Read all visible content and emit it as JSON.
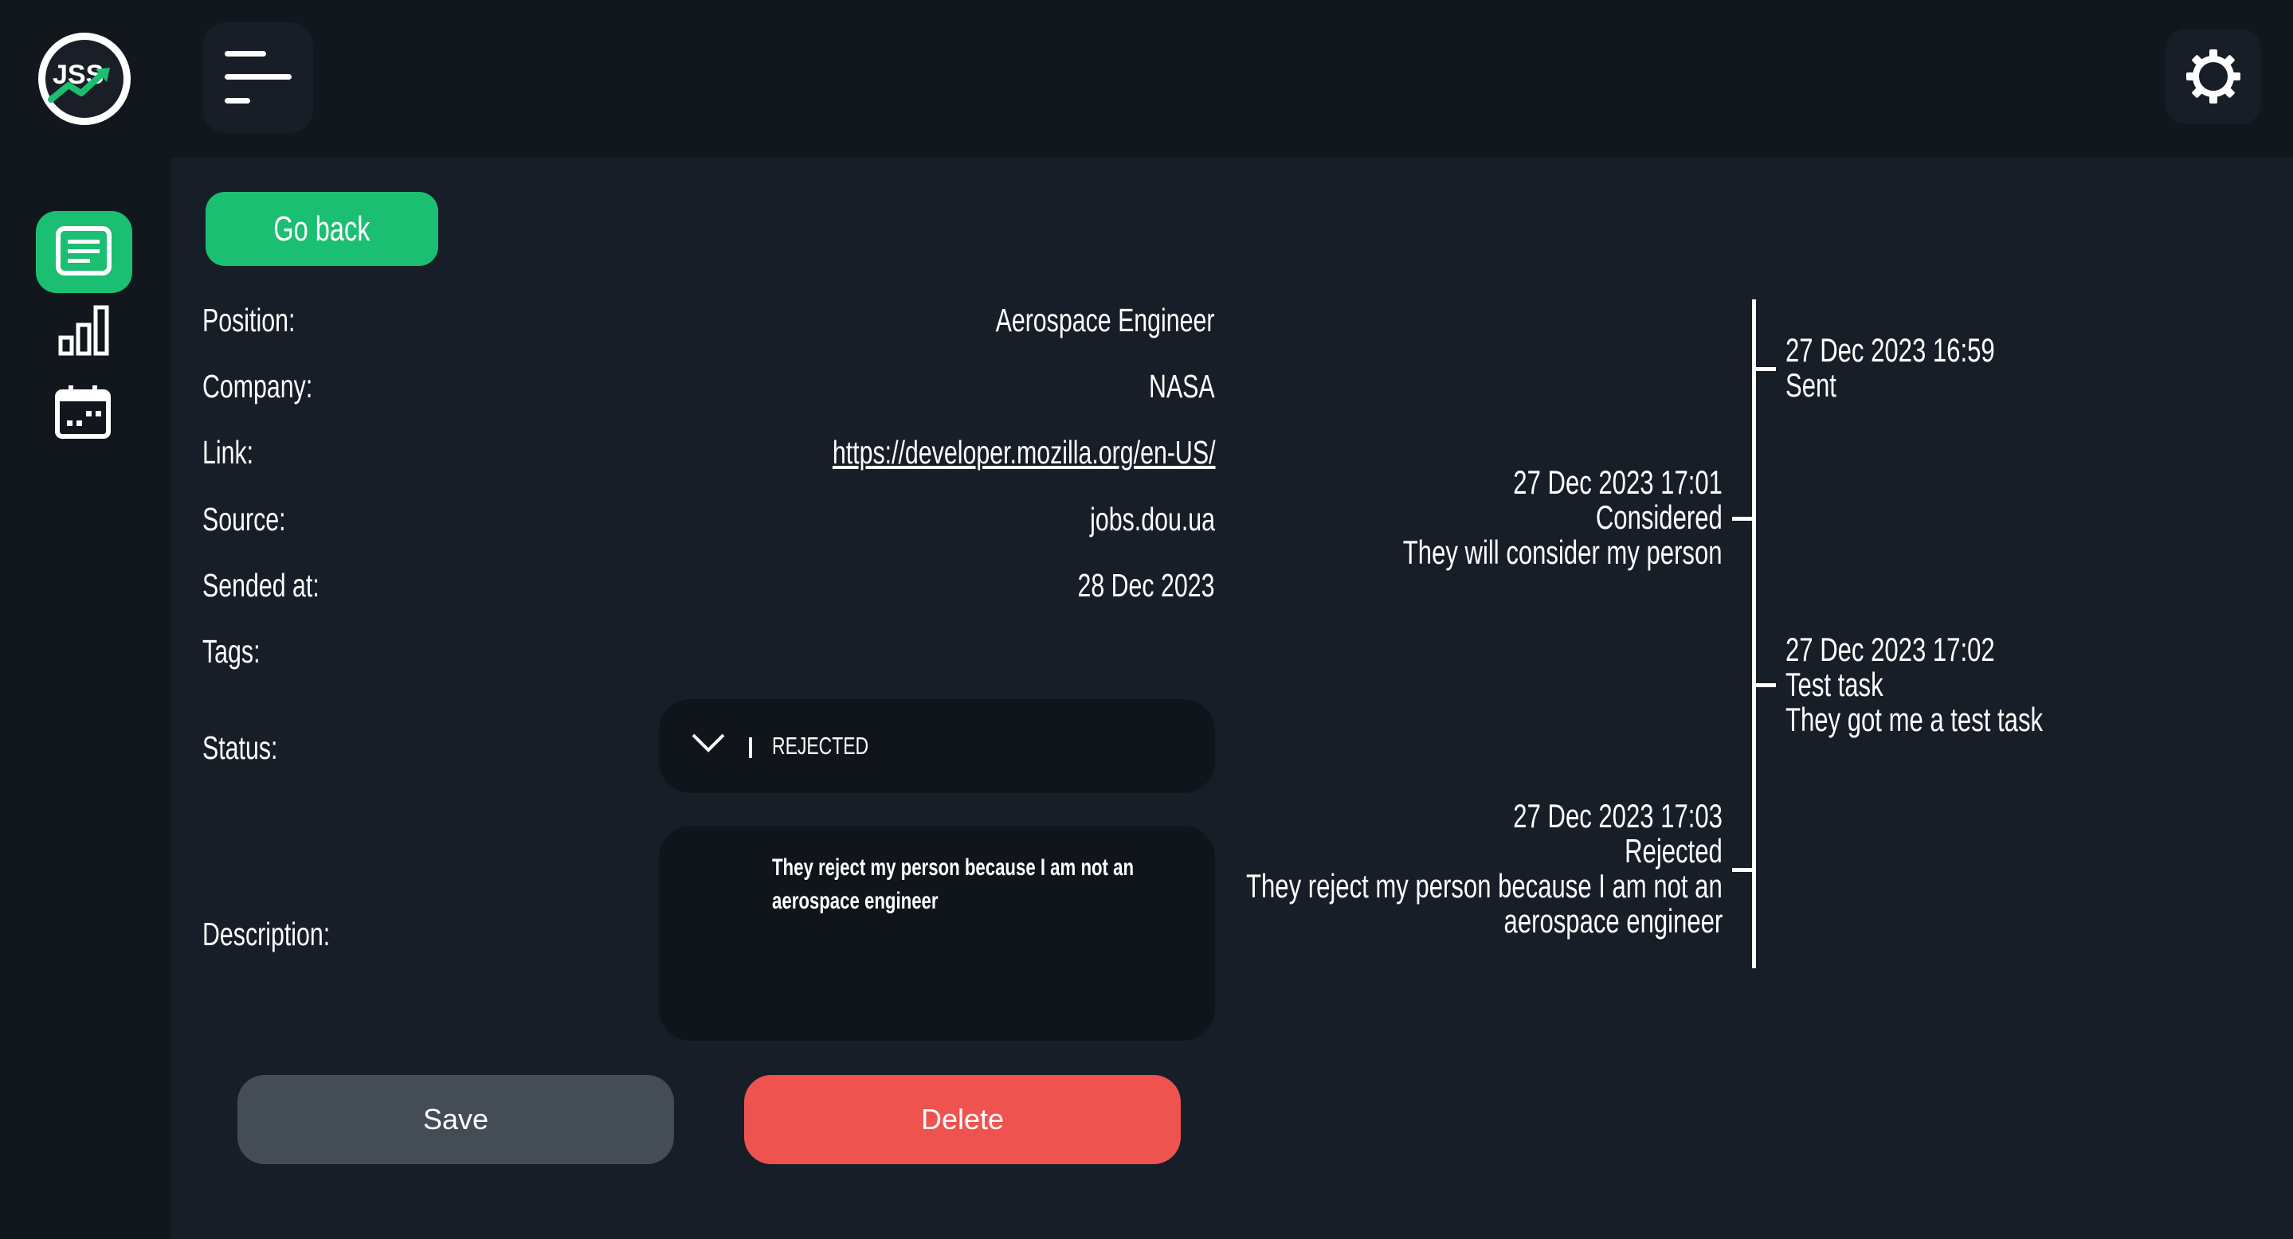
{
  "app": {
    "logo_text": "JSS"
  },
  "header": {
    "menu_icon": "hamburger-icon",
    "settings_icon": "gear-icon"
  },
  "sidebar": {
    "items": [
      {
        "name": "applications",
        "icon": "list-icon",
        "active": true
      },
      {
        "name": "statistics",
        "icon": "bar-chart-icon",
        "active": false
      },
      {
        "name": "calendar",
        "icon": "calendar-icon",
        "active": false
      }
    ]
  },
  "actions": {
    "go_back": "Go back",
    "save": "Save",
    "delete": "Delete"
  },
  "fields": {
    "position": {
      "label": "Position:",
      "value": "Aerospace Engineer"
    },
    "company": {
      "label": "Company:",
      "value": "NASA"
    },
    "link": {
      "label": "Link:",
      "value": "https://developer.mozilla.org/en-US/"
    },
    "source": {
      "label": "Source:",
      "value": "jobs.dou.ua"
    },
    "sended_at": {
      "label": "Sended at:",
      "value": "28 Dec 2023"
    },
    "tags": {
      "label": "Tags:"
    },
    "status": {
      "label": "Status:",
      "value": "REJECTED"
    },
    "description": {
      "label": "Description:",
      "value": "They reject my person because I am not an aerospace engineer"
    }
  },
  "timeline": [
    {
      "date": "27 Dec 2023 16:59",
      "status": "Sent",
      "note": ""
    },
    {
      "date": "27 Dec 2023 17:01",
      "status": "Considered",
      "note": "They will consider my person"
    },
    {
      "date": "27 Dec 2023 17:02",
      "status": "Test task",
      "note": "They got me a test task"
    },
    {
      "date": "27 Dec 2023 17:03",
      "status": "Rejected",
      "note_lines": [
        "They reject my person because I am not an",
        "aerospace engineer"
      ]
    }
  ],
  "colors": {
    "accent": "#1bbf72",
    "danger": "#ef5350",
    "background": "#171e28",
    "panel": "#12171e"
  }
}
